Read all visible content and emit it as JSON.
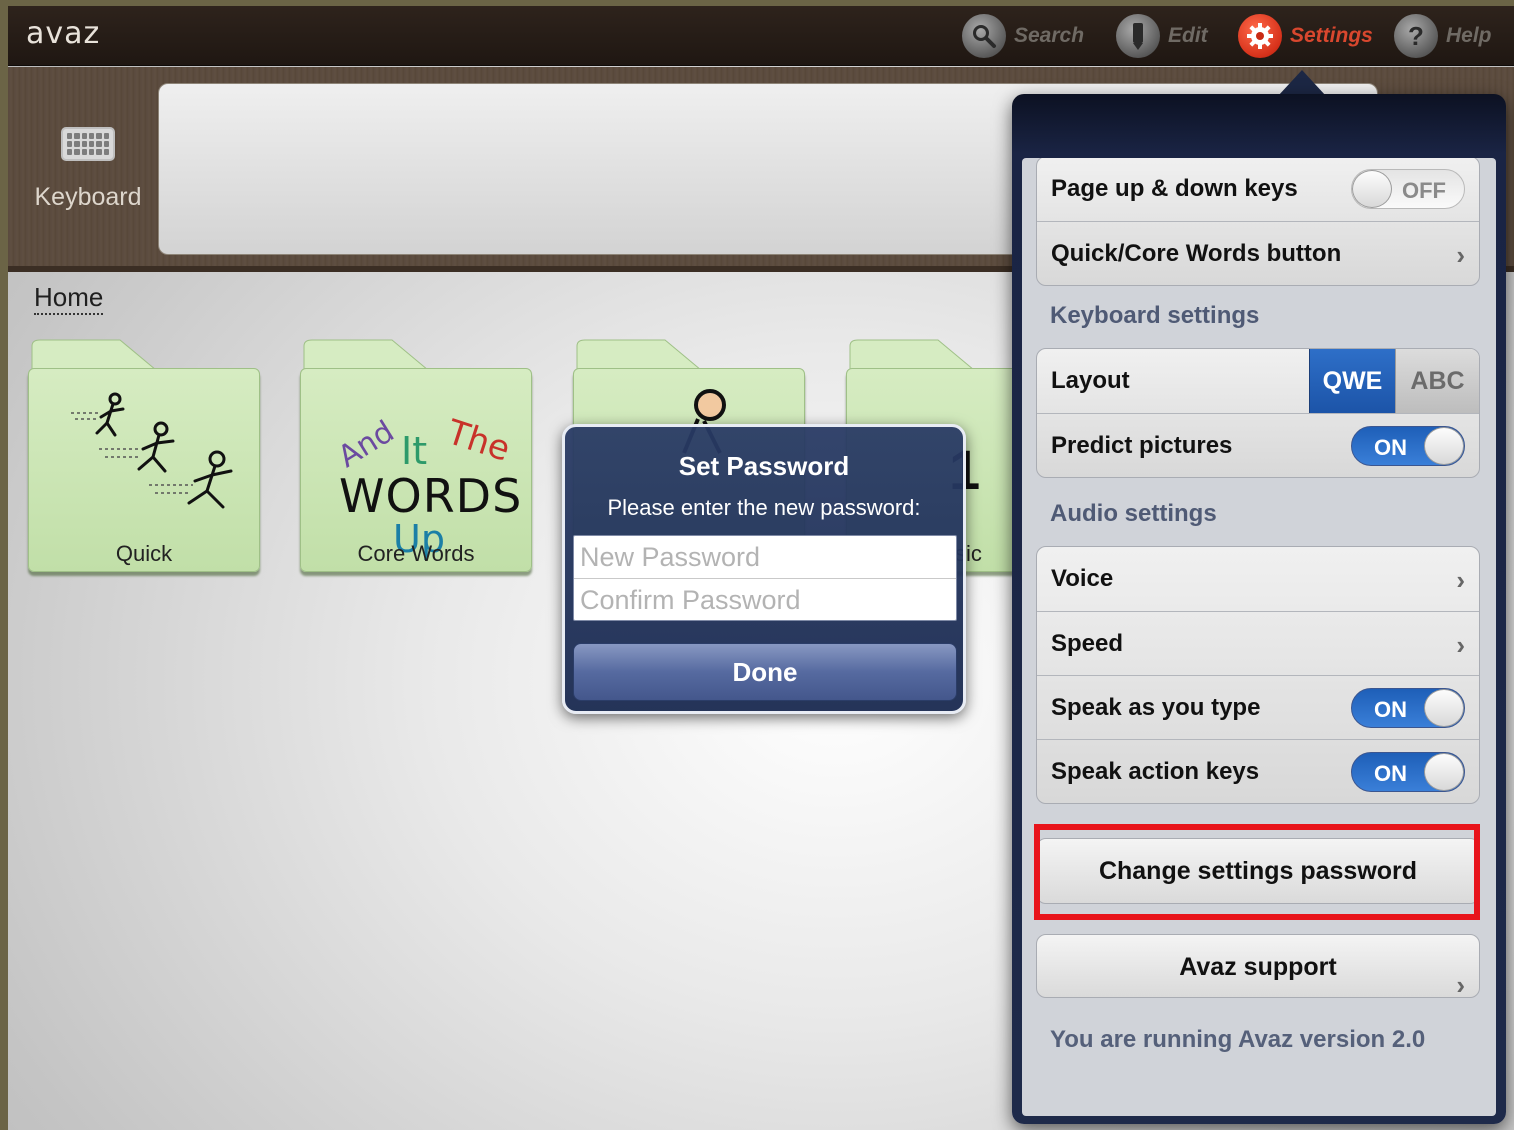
{
  "app": {
    "logo": "avaz"
  },
  "topbar": {
    "search": "Search",
    "edit": "Edit",
    "settings": "Settings",
    "help": "Help",
    "help_glyph": "?"
  },
  "keyboard": {
    "label": "Keyboard"
  },
  "breadcrumb": {
    "home": "Home"
  },
  "folders": [
    {
      "label": "Quick",
      "icon": "running-figures-icon"
    },
    {
      "label": "Core Words",
      "words": [
        "And",
        "It",
        "The",
        "WORDS",
        "Up"
      ]
    },
    {
      "label": "",
      "icon": "person-icon"
    },
    {
      "label": "sic",
      "glyph": "1"
    }
  ],
  "dialog": {
    "title": "Set Password",
    "message": "Please enter the new password:",
    "new_placeholder": "New Password",
    "confirm_placeholder": "Confirm Password",
    "done": "Done"
  },
  "settings": {
    "top_rows": [
      {
        "label": "Page up & down keys",
        "toggle": "OFF"
      },
      {
        "label": "Quick/Core Words button",
        "chevron": "›"
      }
    ],
    "keyboard_header": "Keyboard settings",
    "keyboard_rows": [
      {
        "label": "Layout",
        "segments": [
          "QWE",
          "ABC"
        ],
        "selected": "QWE"
      },
      {
        "label": "Predict pictures",
        "toggle": "ON"
      }
    ],
    "audio_header": "Audio settings",
    "audio_rows": [
      {
        "label": "Voice",
        "chevron": "›"
      },
      {
        "label": "Speed",
        "chevron": "›"
      },
      {
        "label": "Speak as you type",
        "toggle": "ON"
      },
      {
        "label": "Speak action keys",
        "toggle": "ON"
      }
    ],
    "password_button": "Change settings password",
    "support_button": "Avaz support",
    "support_chevron": "›",
    "version": "You are running Avaz version 2.0"
  },
  "colors": {
    "highlight": "#e8141b",
    "toggle_on": "#1e5fb8",
    "settings_accent": "#d6311a"
  }
}
